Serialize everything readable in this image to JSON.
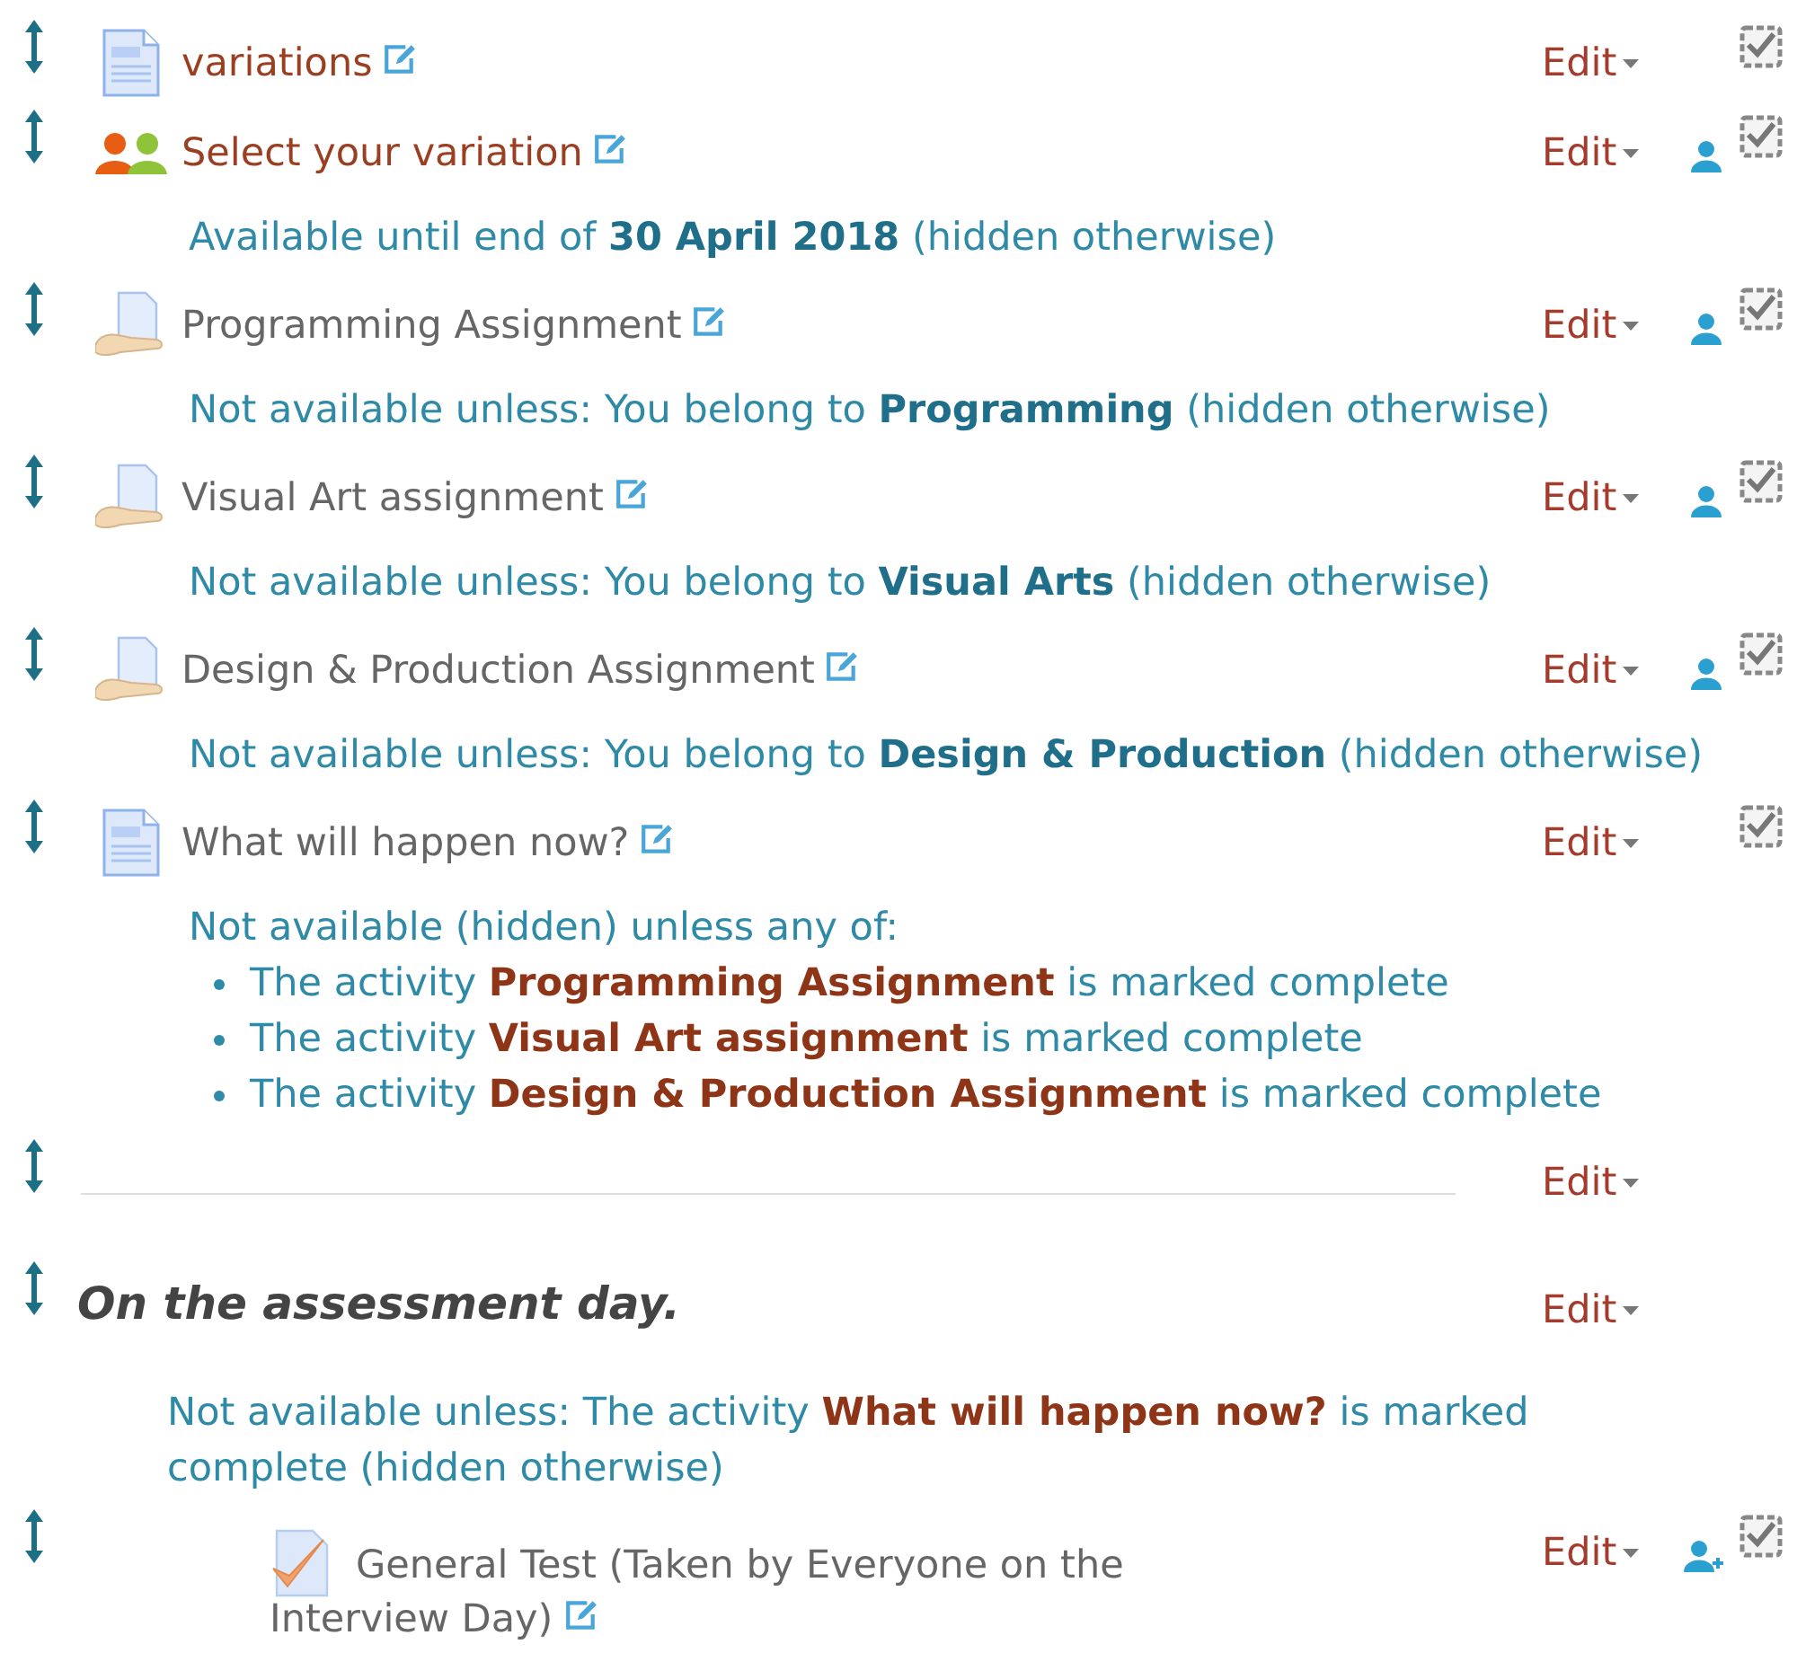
{
  "rows": [
    {
      "kind": "page",
      "title": "variations",
      "dimmed": false,
      "edit": "Edit",
      "groups": false,
      "group_add": false,
      "completion_checked": true
    },
    {
      "kind": "choice",
      "title": "Select your variation",
      "dimmed": false,
      "edit": "Edit",
      "groups": true,
      "group_add": false,
      "completion_checked": true,
      "restriction": {
        "kind": "date",
        "text": "Available until end of **30 April 2018** (hidden otherwise)"
      }
    },
    {
      "kind": "assign",
      "title": "Programming Assignment",
      "dimmed": true,
      "edit": "Edit",
      "groups": true,
      "group_add": false,
      "completion_checked": true,
      "restriction": {
        "kind": "group",
        "text": "Not available unless: You belong to **Programming** (hidden otherwise)"
      }
    },
    {
      "kind": "assign",
      "title": "Visual Art assignment",
      "dimmed": true,
      "edit": "Edit",
      "groups": true,
      "group_add": false,
      "completion_checked": true,
      "restriction": {
        "kind": "group",
        "text": "Not available unless: You belong to **Visual Arts** (hidden otherwise)"
      }
    },
    {
      "kind": "assign",
      "title": "Design & Production Assignment",
      "dimmed": true,
      "edit": "Edit",
      "groups": true,
      "group_add": false,
      "completion_checked": true,
      "restriction": {
        "kind": "group",
        "text": "Not available unless: You belong to **Design & Production** (hidden otherwise)"
      }
    },
    {
      "kind": "page",
      "title": "What will happen now?",
      "dimmed": true,
      "edit": "Edit",
      "groups": false,
      "group_add": false,
      "completion_checked": true,
      "restriction": {
        "kind": "activity",
        "text": "Not available (hidden) unless any of:",
        "conditions": [
          "The activity **Programming Assignment** is marked complete",
          "The activity **Visual Art assignment** is marked complete",
          "The activity **Design & Production Assignment** is marked complete"
        ]
      }
    },
    {
      "kind": "label",
      "edit": "Edit"
    },
    {
      "kind": "section",
      "title": "On the assessment day.",
      "edit": "Edit",
      "restriction": {
        "kind": "activity",
        "text": "Not available unless: The activity **What will happen now?** is marked complete (hidden otherwise)"
      },
      "children": [
        {
          "kind": "quiz",
          "title": "General Test (Taken by Everyone on the Interview Day)",
          "dimmed": true,
          "edit": "Edit",
          "groups": true,
          "group_add": true,
          "completion_checked": true
        }
      ]
    }
  ]
}
